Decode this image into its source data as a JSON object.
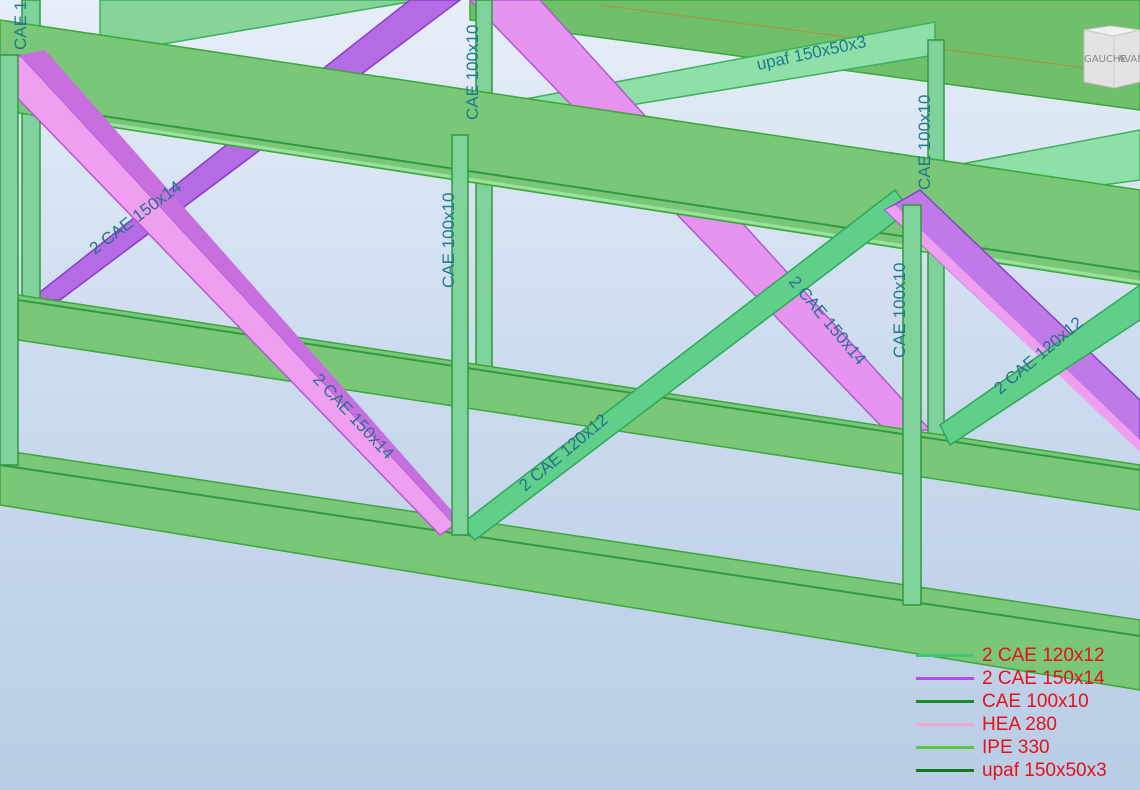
{
  "viewport": {
    "background_top": "#e6eef8",
    "background_bottom": "#b9cde6"
  },
  "view_cube": {
    "left_face_label": "GAUCHE",
    "front_face_label": "AVANT"
  },
  "member_labels": {
    "top_left_vertical": "CAE 1",
    "mid_top_vertical": "CAE 100x10",
    "mid_vertical": "CAE 100x10",
    "right_top_vertical": "CAE 100x10",
    "right_mid_vertical": "CAE 100x10",
    "upper_purlin": "upaf 150x50x3",
    "diag_left_upper": "2 CAE 150x14",
    "diag_left_lower": "2 CAE 150x14",
    "diag_center": "2 CAE 120x12",
    "diag_right_purple": "2 CAE 150x14",
    "diag_right_green": "2 CAE 120x12"
  },
  "legend": [
    {
      "label": "2 CAE 120x12",
      "color": "#3fc77a"
    },
    {
      "label": "2 CAE 150x14",
      "color": "#b04ee8"
    },
    {
      "label": "CAE 100x10",
      "color": "#1a8a2a"
    },
    {
      "label": "HEA 280",
      "color": "#f2a8c8"
    },
    {
      "label": "IPE 330",
      "color": "#5cc93a"
    },
    {
      "label": "upaf 150x50x3",
      "color": "#137a1d"
    }
  ],
  "colors": {
    "beam_fill": "#79c777",
    "beam_edge": "#3aa83a",
    "purple": "#c07ae8",
    "pink": "#f09ef0",
    "teal_brace": "#5fcf8a",
    "label_text": "#1f7a8c",
    "legend_text": "#e8101a"
  }
}
